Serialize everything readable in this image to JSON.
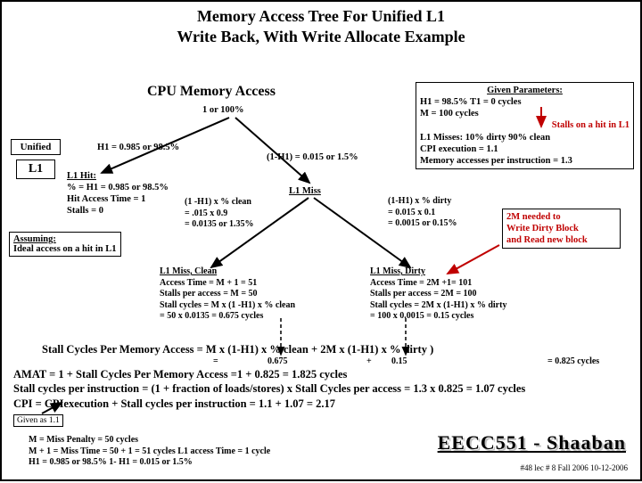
{
  "title1": "Memory Access Tree For Unified L1",
  "title2": "Write Back,  With Write Allocate Example",
  "cpu_heading": "CPU Memory  Access",
  "root_prob": "1 or 100%",
  "unified_label": "Unified",
  "L1_label": "L1",
  "h1_label": "H1 = 0.985 or 98.5%",
  "miss_prob": "(1-H1) = 0.015 or 1.5%",
  "hit": {
    "title": "L1  Hit:",
    "l1": "% = H1 = 0.985 or 98.5%",
    "l2": "Hit Access Time = 1",
    "l3": "Stalls = 0"
  },
  "miss_label": "L1  Miss",
  "clean": {
    "p1": "(1 -H1)  x  % clean",
    "p2": "=  .015 x 0.9",
    "p3": "= 0.0135 or 1.35%"
  },
  "dirty": {
    "p1": "(1-H1)  x  % dirty",
    "p2": " =  0.015 x 0.1",
    "p3": " =  0.0015 or 0.15%"
  },
  "miss_clean": {
    "title": "L1  Miss,  Clean",
    "l1": "Access Time =  M + 1 = 51",
    "l2": "Stalls per access = M  = 50",
    "l3": "Stall cycles =  M x (1 -H1)  x  % clean",
    "l4": "               =   50 x   0.0135 = 0.675  cycles"
  },
  "miss_dirty": {
    "title": "L1  Miss, Dirty",
    "l1": "Access Time =  2M +1= 101",
    "l2": "Stalls per access =  2M  = 100",
    "l3": "Stall cycles =  2M x (1-H1)  x  %  dirty",
    "l4": "                    =   100 x 0.0015 =  0.15  cycles"
  },
  "params": {
    "title": "Given Parameters:",
    "h1": "H1  = 98.5%        T1  = 0 cycles",
    "m": "M = 100 cycles",
    "stalls": "Stalls on a hit in L1",
    "misses": "L1 Misses:   10%  dirty  90% clean",
    "cpi": "CPI execution = 1.1",
    "mapi": "Memory accesses per instruction = 1.3"
  },
  "note2m": {
    "l1": "2M needed to",
    "l2": "Write Dirty Block",
    "l3": "and Read new block"
  },
  "assuming": {
    "l1": "Assuming:",
    "l2": "Ideal access on a hit in L1"
  },
  "calc": {
    "l1a": "Stall Cycles Per Memory Access =         M x (1-H1)  x  % clean   +  2M  x (1-H1) x % dirty )",
    "l1b_eq": "=",
    "l1b_v1": "0.675",
    "l1b_plus": "+",
    "l1b_v2": "0.15",
    "l1b_res": "=  0.825 cycles",
    "l2": "AMAT =   1 + Stall Cycles Per Memory Access  =1  +  0.825 =  1.825  cycles",
    "l3": "Stall cycles per instruction = (1  + fraction of loads/stores) x Stall Cycles per access = 1.3 x 0.825 =  1.07  cycles",
    "l4": "CPI =  CPIexecution  + Stall cycles per instruction  =   1.1 + 1.07  =  2.17"
  },
  "given_small": "Given as 1.1",
  "footnotes": {
    "l1": "M  =  Miss Penalty = 50 cycles",
    "l2": "M + 1  =  Miss Time = 50 + 1 = 51 cycles     L1 access Time = 1 cycle",
    "l3": "H1  =  0.985   or 98.5%              1- H1 = 0.015   or   1.5%"
  },
  "footer_big": "EECC551 - Shaaban",
  "footer_small": "#48   lec # 8     Fall 2006   10-12-2006"
}
